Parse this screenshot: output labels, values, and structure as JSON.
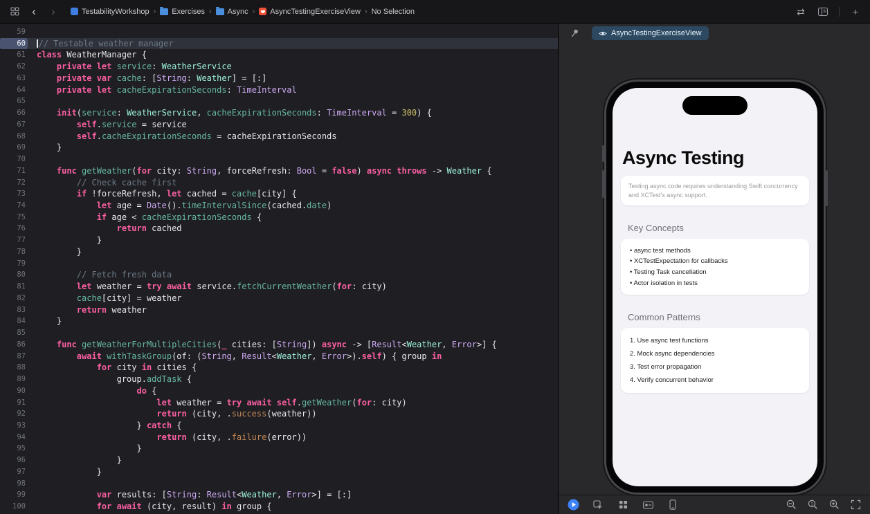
{
  "topbar": {
    "back_glyph": "‹",
    "forward_glyph": "›",
    "breadcrumb": [
      {
        "icon": "project-icon",
        "label": "TestabilityWorkshop"
      },
      {
        "icon": "folder-icon",
        "label": "Exercises"
      },
      {
        "icon": "folder-icon",
        "label": "Async"
      },
      {
        "icon": "swift-file-icon",
        "label": "AsyncTestingExerciseView"
      },
      {
        "icon": null,
        "label": "No Selection"
      }
    ],
    "right_icons": [
      "code-review-icon",
      "editor-options-icon",
      "add-editor-icon"
    ]
  },
  "editor": {
    "current_line": 60,
    "lines": [
      {
        "n": 59,
        "t": []
      },
      {
        "n": 60,
        "hl": true,
        "t": [
          [
            "c",
            "// Testable weather manager"
          ]
        ]
      },
      {
        "n": 61,
        "t": [
          [
            "k",
            "class"
          ],
          [
            "p",
            " WeatherManager {"
          ]
        ]
      },
      {
        "n": 62,
        "t": [
          [
            "k",
            "    private let"
          ],
          [
            "p",
            " "
          ],
          [
            "f",
            "service"
          ],
          [
            "p",
            ": "
          ],
          [
            "y",
            "WeatherService"
          ]
        ]
      },
      {
        "n": 63,
        "t": [
          [
            "k",
            "    private var"
          ],
          [
            "p",
            " "
          ],
          [
            "f",
            "cache"
          ],
          [
            "p",
            ": ["
          ],
          [
            "t",
            "String"
          ],
          [
            "p",
            ": "
          ],
          [
            "y",
            "Weather"
          ],
          [
            "p",
            "] = [:]"
          ]
        ]
      },
      {
        "n": 64,
        "t": [
          [
            "k",
            "    private let"
          ],
          [
            "p",
            " "
          ],
          [
            "f",
            "cacheExpirationSeconds"
          ],
          [
            "p",
            ": "
          ],
          [
            "t",
            "TimeInterval"
          ]
        ]
      },
      {
        "n": 65,
        "t": []
      },
      {
        "n": 66,
        "t": [
          [
            "k",
            "    init"
          ],
          [
            "p",
            "("
          ],
          [
            "f",
            "service"
          ],
          [
            "p",
            ": "
          ],
          [
            "y",
            "WeatherService"
          ],
          [
            "p",
            ", "
          ],
          [
            "f",
            "cacheExpirationSeconds"
          ],
          [
            "p",
            ": "
          ],
          [
            "t",
            "TimeInterval"
          ],
          [
            "p",
            " = "
          ],
          [
            "n",
            "300"
          ],
          [
            "p",
            ") {"
          ]
        ]
      },
      {
        "n": 67,
        "t": [
          [
            "k",
            "        self"
          ],
          [
            "p",
            "."
          ],
          [
            "f",
            "service"
          ],
          [
            "p",
            " = service"
          ]
        ]
      },
      {
        "n": 68,
        "t": [
          [
            "k",
            "        self"
          ],
          [
            "p",
            "."
          ],
          [
            "f",
            "cacheExpirationSeconds"
          ],
          [
            "p",
            " = cacheExpirationSeconds"
          ]
        ]
      },
      {
        "n": 69,
        "t": [
          [
            "p",
            "    }"
          ]
        ]
      },
      {
        "n": 70,
        "t": []
      },
      {
        "n": 71,
        "t": [
          [
            "k",
            "    func"
          ],
          [
            "p",
            " "
          ],
          [
            "f",
            "getWeather"
          ],
          [
            "p",
            "("
          ],
          [
            "k",
            "for"
          ],
          [
            "p",
            " city: "
          ],
          [
            "t",
            "String"
          ],
          [
            "p",
            ", forceRefresh: "
          ],
          [
            "t",
            "Bool"
          ],
          [
            "p",
            " = "
          ],
          [
            "k",
            "false"
          ],
          [
            "p",
            ") "
          ],
          [
            "k",
            "async"
          ],
          [
            "p",
            " "
          ],
          [
            "k",
            "throws"
          ],
          [
            "p",
            " -> "
          ],
          [
            "y",
            "Weather"
          ],
          [
            "p",
            " {"
          ]
        ]
      },
      {
        "n": 72,
        "t": [
          [
            "c",
            "        // Check cache first"
          ]
        ]
      },
      {
        "n": 73,
        "t": [
          [
            "k",
            "        if"
          ],
          [
            "p",
            " !forceRefresh, "
          ],
          [
            "k",
            "let"
          ],
          [
            "p",
            " cached = "
          ],
          [
            "f",
            "cache"
          ],
          [
            "p",
            "[city] {"
          ]
        ]
      },
      {
        "n": 74,
        "t": [
          [
            "k",
            "            let"
          ],
          [
            "p",
            " age = "
          ],
          [
            "t",
            "Date"
          ],
          [
            "p",
            "()."
          ],
          [
            "f",
            "timeIntervalSince"
          ],
          [
            "p",
            "(cached."
          ],
          [
            "f",
            "date"
          ],
          [
            "p",
            ")"
          ]
        ]
      },
      {
        "n": 75,
        "t": [
          [
            "k",
            "            if"
          ],
          [
            "p",
            " age < "
          ],
          [
            "f",
            "cacheExpirationSeconds"
          ],
          [
            "p",
            " {"
          ]
        ]
      },
      {
        "n": 76,
        "t": [
          [
            "k",
            "                return"
          ],
          [
            "p",
            " cached"
          ]
        ]
      },
      {
        "n": 77,
        "t": [
          [
            "p",
            "            }"
          ]
        ]
      },
      {
        "n": 78,
        "t": [
          [
            "p",
            "        }"
          ]
        ]
      },
      {
        "n": 79,
        "t": []
      },
      {
        "n": 80,
        "t": [
          [
            "c",
            "        // Fetch fresh data"
          ]
        ]
      },
      {
        "n": 81,
        "t": [
          [
            "k",
            "        let"
          ],
          [
            "p",
            " weather = "
          ],
          [
            "k",
            "try"
          ],
          [
            "p",
            " "
          ],
          [
            "k",
            "await"
          ],
          [
            "p",
            " service."
          ],
          [
            "f",
            "fetchCurrentWeather"
          ],
          [
            "p",
            "("
          ],
          [
            "k",
            "for"
          ],
          [
            "p",
            ": city)"
          ]
        ]
      },
      {
        "n": 82,
        "t": [
          [
            "p",
            "        "
          ],
          [
            "f",
            "cache"
          ],
          [
            "p",
            "[city] = weather"
          ]
        ]
      },
      {
        "n": 83,
        "t": [
          [
            "k",
            "        return"
          ],
          [
            "p",
            " weather"
          ]
        ]
      },
      {
        "n": 84,
        "t": [
          [
            "p",
            "    }"
          ]
        ]
      },
      {
        "n": 85,
        "t": []
      },
      {
        "n": 86,
        "t": [
          [
            "k",
            "    func"
          ],
          [
            "p",
            " "
          ],
          [
            "f",
            "getWeatherForMultipleCities"
          ],
          [
            "p",
            "("
          ],
          [
            "k",
            "_"
          ],
          [
            "p",
            " cities: ["
          ],
          [
            "t",
            "String"
          ],
          [
            "p",
            "]) "
          ],
          [
            "k",
            "async"
          ],
          [
            "p",
            " -> ["
          ],
          [
            "t",
            "Result"
          ],
          [
            "p",
            "<"
          ],
          [
            "y",
            "Weather"
          ],
          [
            "p",
            ", "
          ],
          [
            "t",
            "Error"
          ],
          [
            "p",
            ">] {"
          ]
        ]
      },
      {
        "n": 87,
        "t": [
          [
            "k",
            "        await"
          ],
          [
            "p",
            " "
          ],
          [
            "f",
            "withTaskGroup"
          ],
          [
            "p",
            "(of: ("
          ],
          [
            "t",
            "String"
          ],
          [
            "p",
            ", "
          ],
          [
            "t",
            "Result"
          ],
          [
            "p",
            "<"
          ],
          [
            "y",
            "Weather"
          ],
          [
            "p",
            ", "
          ],
          [
            "t",
            "Error"
          ],
          [
            "p",
            ">)."
          ],
          [
            "k",
            "self"
          ],
          [
            "p",
            ") { group "
          ],
          [
            "k",
            "in"
          ]
        ]
      },
      {
        "n": 88,
        "t": [
          [
            "k",
            "            for"
          ],
          [
            "p",
            " city "
          ],
          [
            "k",
            "in"
          ],
          [
            "p",
            " cities {"
          ]
        ]
      },
      {
        "n": 89,
        "t": [
          [
            "p",
            "                group."
          ],
          [
            "f",
            "addTask"
          ],
          [
            "p",
            " {"
          ]
        ]
      },
      {
        "n": 90,
        "t": [
          [
            "k",
            "                    do"
          ],
          [
            "p",
            " {"
          ]
        ]
      },
      {
        "n": 91,
        "t": [
          [
            "k",
            "                        let"
          ],
          [
            "p",
            " weather = "
          ],
          [
            "k",
            "try"
          ],
          [
            "p",
            " "
          ],
          [
            "k",
            "await"
          ],
          [
            "p",
            " "
          ],
          [
            "k",
            "self"
          ],
          [
            "p",
            "."
          ],
          [
            "f",
            "getWeather"
          ],
          [
            "p",
            "("
          ],
          [
            "k",
            "for"
          ],
          [
            "p",
            ": city)"
          ]
        ]
      },
      {
        "n": 92,
        "t": [
          [
            "k",
            "                        return"
          ],
          [
            "p",
            " (city, ."
          ],
          [
            "e",
            "success"
          ],
          [
            "p",
            "(weather))"
          ]
        ]
      },
      {
        "n": 93,
        "t": [
          [
            "p",
            "                    } "
          ],
          [
            "k",
            "catch"
          ],
          [
            "p",
            " {"
          ]
        ]
      },
      {
        "n": 94,
        "t": [
          [
            "k",
            "                        return"
          ],
          [
            "p",
            " (city, ."
          ],
          [
            "e",
            "failure"
          ],
          [
            "p",
            "(error))"
          ]
        ]
      },
      {
        "n": 95,
        "t": [
          [
            "p",
            "                    }"
          ]
        ]
      },
      {
        "n": 96,
        "t": [
          [
            "p",
            "                }"
          ]
        ]
      },
      {
        "n": 97,
        "t": [
          [
            "p",
            "            }"
          ]
        ]
      },
      {
        "n": 98,
        "t": []
      },
      {
        "n": 99,
        "t": [
          [
            "k",
            "            var"
          ],
          [
            "p",
            " results: ["
          ],
          [
            "t",
            "String"
          ],
          [
            "p",
            ": "
          ],
          [
            "t",
            "Result"
          ],
          [
            "p",
            "<"
          ],
          [
            "y",
            "Weather"
          ],
          [
            "p",
            ", "
          ],
          [
            "t",
            "Error"
          ],
          [
            "p",
            ">] = [:]"
          ]
        ]
      },
      {
        "n": 100,
        "t": [
          [
            "k",
            "            for"
          ],
          [
            "p",
            " "
          ],
          [
            "k",
            "await"
          ],
          [
            "p",
            " (city, result) "
          ],
          [
            "k",
            "in"
          ],
          [
            "p",
            " group {"
          ]
        ]
      }
    ]
  },
  "canvas": {
    "tab_label": "AsyncTestingExerciseView",
    "preview": {
      "title": "Async Testing",
      "description": "Testing async code requires understanding Swift concurrency and XCTest's async support.",
      "sections": [
        {
          "heading": "Key Concepts",
          "style": "bullets",
          "items": [
            "async test methods",
            "XCTestExpectation for callbacks",
            "Testing Task cancellation",
            "Actor isolation in tests"
          ]
        },
        {
          "heading": "Common Patterns",
          "style": "numbers",
          "items": [
            "Use async test functions",
            "Mock async dependencies",
            "Test error propagation",
            "Verify concurrent behavior"
          ]
        }
      ]
    },
    "bottom_bar": {
      "left_icons": [
        "live-preview-play-icon",
        "selectable-mode-icon",
        "variants-icon",
        "device-settings-icon",
        "device-icon"
      ],
      "right_icons": [
        "zoom-out-icon",
        "zoom-actual-size-icon",
        "zoom-in-icon",
        "zoom-to-fit-icon"
      ]
    }
  },
  "colors": {
    "accent_blue": "#3d82f7",
    "keyword_pink": "#fc5fa3",
    "comment_gray": "#6c7986",
    "number_yellow": "#d0bf69",
    "member_teal": "#67b7a4",
    "sdk_type_lavender": "#cda9f2",
    "project_type_mint": "#9ef1dd",
    "chip_blue": "#2c4961",
    "swift_orange": "#f05138"
  }
}
